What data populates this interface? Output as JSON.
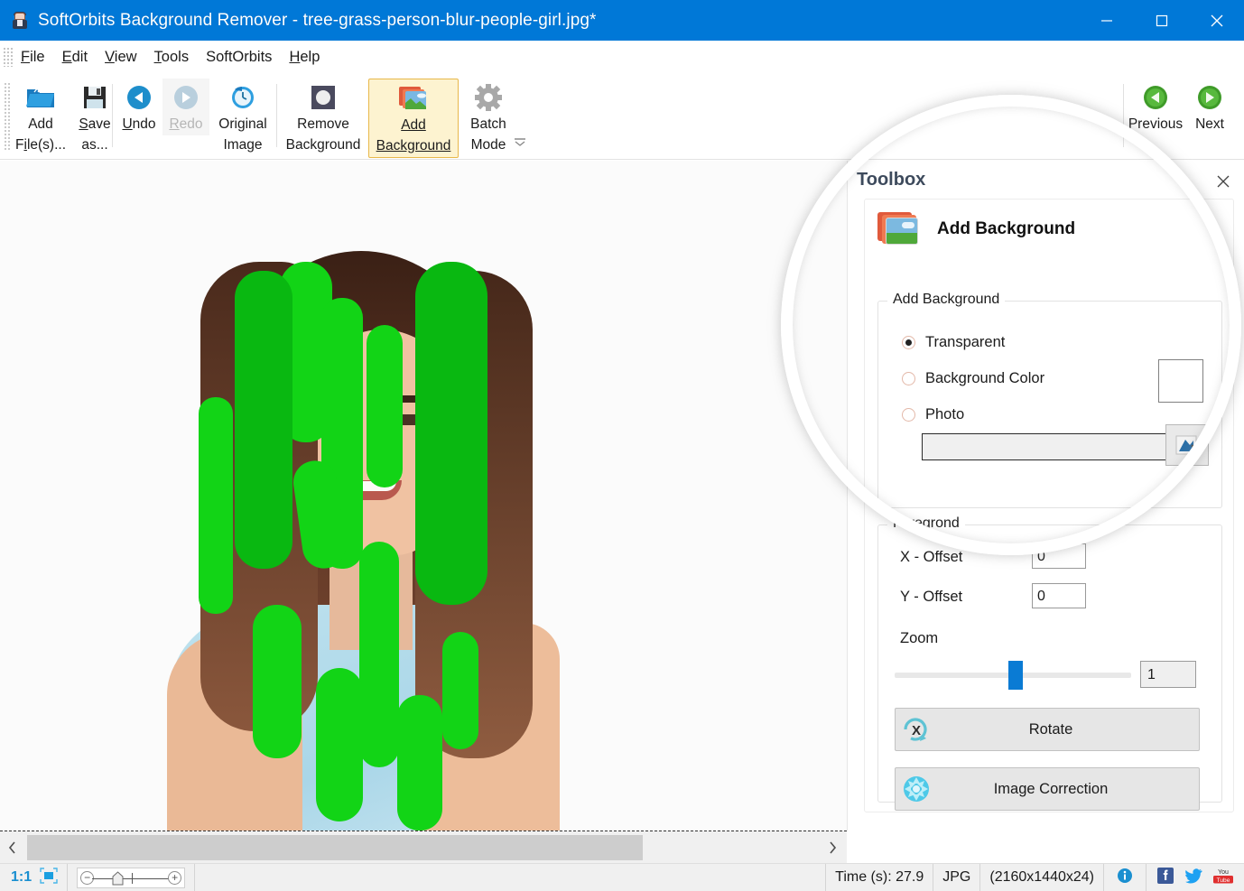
{
  "window": {
    "title": "SoftOrbits Background Remover - tree-grass-person-blur-people-girl.jpg*",
    "app_icon": "app-person-icon",
    "minimize": "minimize-icon",
    "maximize": "maximize-icon",
    "close": "close-icon",
    "titlebar_color": "#0078d7"
  },
  "menubar": {
    "items": [
      {
        "label": "File",
        "mnemonic": "F"
      },
      {
        "label": "Edit",
        "mnemonic": "E"
      },
      {
        "label": "View",
        "mnemonic": "V"
      },
      {
        "label": "Tools",
        "mnemonic": "T"
      },
      {
        "label": "SoftOrbits",
        "mnemonic": ""
      },
      {
        "label": "Help",
        "mnemonic": "H"
      }
    ]
  },
  "toolbar": {
    "add_files": {
      "line1": "Add",
      "line2": "File(s)...",
      "icon": "open-folder-icon"
    },
    "save_as": {
      "line1": "Save",
      "line2": "as...",
      "icon": "floppy-disk-icon"
    },
    "undo": {
      "label": "Undo",
      "icon": "undo-arrow-icon"
    },
    "redo": {
      "label": "Redo",
      "icon": "redo-arrow-icon",
      "state": "disabled"
    },
    "original_image": {
      "line1": "Original",
      "line2": "Image",
      "icon": "clock-history-icon"
    },
    "remove_background": {
      "line1": "Remove",
      "line2": "Background",
      "icon": "circle-mask-icon"
    },
    "add_background": {
      "line1": "Add",
      "line2": "Background",
      "icon": "stacked-photo-icon",
      "state": "active"
    },
    "batch_mode": {
      "line1": "Batch",
      "line2": "Mode",
      "icon": "gear-icon"
    },
    "previous": {
      "label": "Previous",
      "icon": "green-left-arrow-icon"
    },
    "next": {
      "label": "Next",
      "icon": "green-right-arrow-icon"
    },
    "overflow": {
      "icon": "chevron-down-icon"
    },
    "active_highlight_color": "#fdf3d0",
    "active_border_color": "#e8b84b"
  },
  "canvas": {
    "vertical_scroll_down": "chevron-down-icon",
    "horizontal_scroll_left": "chevron-left-icon",
    "horizontal_scroll_right": "chevron-right-icon"
  },
  "toolbox": {
    "title": "Toolbox",
    "close": "close-icon",
    "header": {
      "title": "Add Background",
      "icon": "stacked-photo-icon"
    },
    "add_background_group": {
      "legend": "Add Background",
      "options": [
        {
          "label": "Transparent",
          "selected": true
        },
        {
          "label": "Background Color",
          "selected": false
        },
        {
          "label": "Photo",
          "selected": false
        }
      ],
      "color_swatch": "#ffffff",
      "photo_path": "",
      "browse_icon": "browse-folder-icon"
    },
    "foreground_group": {
      "legend": "Foregrond",
      "x_offset": {
        "label": "X - Offset",
        "value": "0"
      },
      "y_offset": {
        "label": "Y - Offset",
        "value": "0"
      },
      "zoom": {
        "label": "Zoom",
        "value": "1",
        "slider_percent": 48
      }
    },
    "rotate_button": {
      "label": "Rotate",
      "icon": "rotate-x-icon"
    },
    "image_correction_button": {
      "label": "Image Correction",
      "icon": "sun-burst-icon"
    }
  },
  "statusbar": {
    "ratio": "1:1",
    "fit_icon": "fit-to-screen-icon",
    "zoom_minus": "minus-icon",
    "zoom_plus": "plus-icon",
    "time": "Time (s): 27.9",
    "format": "JPG",
    "dimensions": "(2160x1440x24)",
    "info_icon": "info-icon",
    "facebook_icon": "facebook-icon",
    "twitter_icon": "twitter-icon",
    "youtube_icon": "youtube-icon"
  }
}
